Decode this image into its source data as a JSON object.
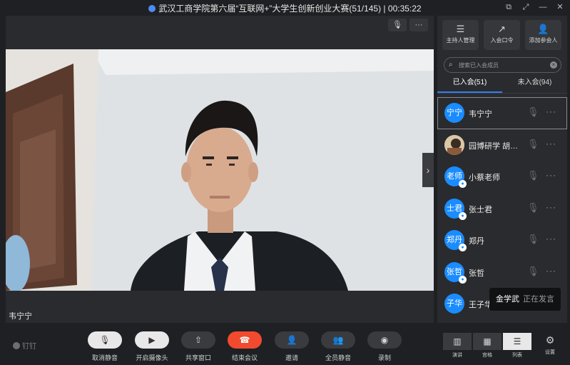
{
  "window": {
    "title": "武汉工商学院第六届“互联网+”大学生创新创业大赛(51/145)",
    "timer": "00:35:22"
  },
  "stage": {
    "speaker_name": "韦宁宁"
  },
  "panel": {
    "buttons": [
      {
        "label": "主持人管理",
        "icon": "sliders-icon"
      },
      {
        "label": "入会口令",
        "icon": "share-icon"
      },
      {
        "label": "添加参会人",
        "icon": "add-person-icon"
      }
    ],
    "search_placeholder": "搜索已入会成员",
    "tabs": [
      {
        "label": "已入会(51)",
        "active": true
      },
      {
        "label": "未入会(94)",
        "active": false
      }
    ],
    "participants": [
      {
        "avatar": "宁宁",
        "name": "韦宁宁",
        "selected": true
      },
      {
        "avatar": "",
        "name": "园博研学  胡…",
        "photo": true
      },
      {
        "avatar": "老师",
        "name": "小蔡老师"
      },
      {
        "avatar": "士君",
        "name": "张士君"
      },
      {
        "avatar": "郑丹",
        "name": "郑丹"
      },
      {
        "avatar": "张哲",
        "name": "张哲"
      },
      {
        "avatar": "子华",
        "name": "王子华"
      }
    ],
    "speaking": {
      "who": "金学武",
      "status": "正在发言"
    }
  },
  "toolbar": {
    "brand": "钉钉",
    "buttons": [
      {
        "label": "取消静音",
        "style": "light"
      },
      {
        "label": "开启摄像头",
        "style": "light"
      },
      {
        "label": "共享窗口",
        "style": "dark"
      },
      {
        "label": "结束会议",
        "style": "red"
      },
      {
        "label": "邀请",
        "style": "dark"
      },
      {
        "label": "全员静音",
        "style": "dark"
      },
      {
        "label": "录制",
        "style": "dark"
      }
    ],
    "views": [
      {
        "label": "演讲",
        "active": false
      },
      {
        "label": "宫格",
        "active": false
      },
      {
        "label": "列表",
        "active": true
      }
    ],
    "settings_label": "设置"
  }
}
